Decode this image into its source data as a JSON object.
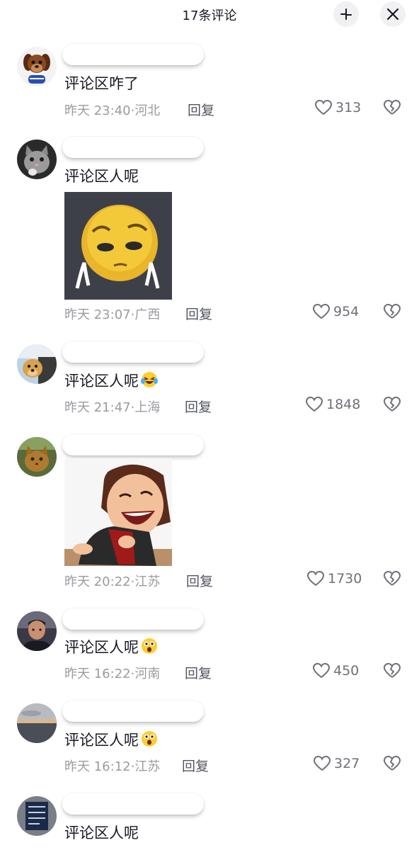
{
  "header": {
    "title": "17条评论",
    "collapse_icon": "collapse-icon",
    "close_icon": "close-icon"
  },
  "comments": [
    {
      "text": "评论区咋了",
      "time": "昨天 23:40",
      "location": "河北",
      "reply": "回复",
      "likes": "313",
      "avatar": "dog-avatar"
    },
    {
      "text": "评论区人呢",
      "time": "昨天 23:07",
      "location": "广西",
      "reply": "回复",
      "likes": "954",
      "avatar": "cat-avatar",
      "sticker": "shy-emoji-sticker"
    },
    {
      "text": "评论区人呢",
      "emoji": "crying-laughing-emoji",
      "time": "昨天 21:47",
      "location": "上海",
      "reply": "回复",
      "likes": "1848",
      "avatar": "dog-car-avatar"
    },
    {
      "text": "",
      "time": "昨天 20:22",
      "location": "江苏",
      "reply": "回复",
      "likes": "1730",
      "avatar": "cat-outdoor-avatar",
      "sticker": "laughing-girl-sticker"
    },
    {
      "text": "评论区人呢",
      "emoji": "shocked-emoji",
      "time": "昨天 16:22",
      "location": "河南",
      "reply": "回复",
      "likes": "450",
      "avatar": "man-avatar"
    },
    {
      "text": "评论区人呢",
      "emoji": "shocked-emoji",
      "time": "昨天 16:12",
      "location": "江苏",
      "reply": "回复",
      "likes": "327",
      "avatar": "sunset-avatar"
    },
    {
      "text": "评论区人呢",
      "avatar": "sign-avatar"
    }
  ],
  "colors": {
    "text": "#161823",
    "meta": "#9a9ba1",
    "icon": "#6e7078"
  }
}
